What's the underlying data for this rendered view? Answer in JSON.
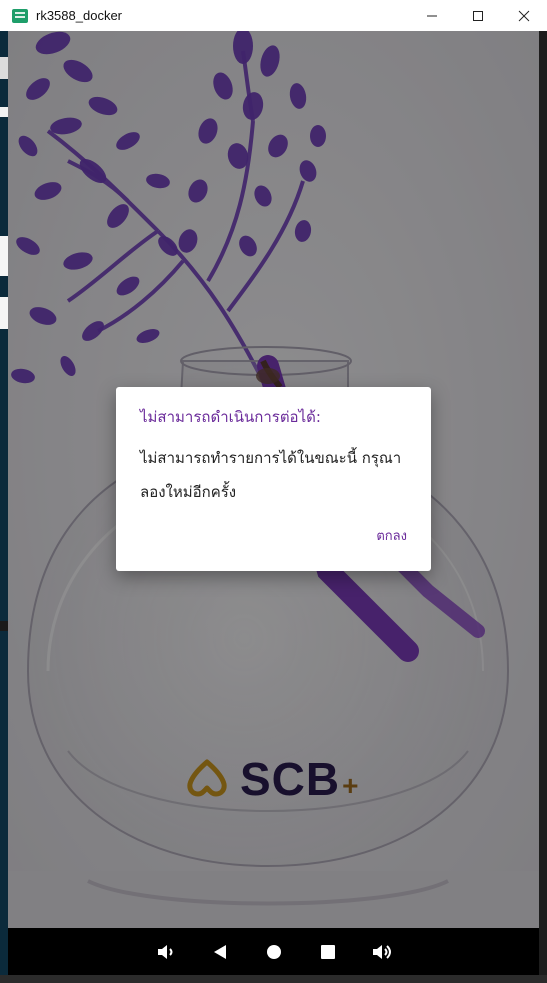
{
  "window": {
    "title": "rk3588_docker",
    "controls": {
      "minimize_icon": "minimize-icon",
      "maximize_icon": "maximize-icon",
      "close_icon": "close-icon"
    }
  },
  "app": {
    "brand": "SCB",
    "brand_plus": "+",
    "colors": {
      "accent": "#6a2a9a",
      "brand_dark": "#2a1d4f",
      "brand_gold": "#c9951e"
    }
  },
  "dialog": {
    "title": "ไม่สามารถดำเนินการต่อได้:",
    "message": "ไม่สามารถทำรายการได้ในขณะนี้ กรุณาลองใหม่อีกครั้ง",
    "ok_label": "ตกลง"
  },
  "navbar": {
    "buttons": [
      {
        "name": "volume-down-icon"
      },
      {
        "name": "back-icon"
      },
      {
        "name": "home-icon"
      },
      {
        "name": "recents-icon"
      },
      {
        "name": "volume-up-icon"
      }
    ]
  }
}
